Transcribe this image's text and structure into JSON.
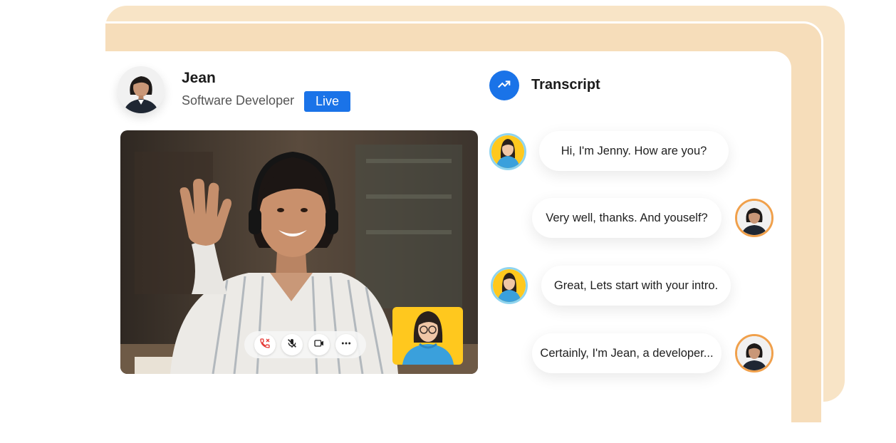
{
  "profile": {
    "name": "Jean",
    "role": "Software Developer",
    "status_badge": "Live"
  },
  "video_controls": [
    {
      "icon": "phone-end-icon",
      "color": "#e53935"
    },
    {
      "icon": "mic-off-icon",
      "color": "#222222"
    },
    {
      "icon": "video-camera-icon",
      "color": "#222222"
    },
    {
      "icon": "more-options-icon",
      "color": "#222222"
    }
  ],
  "transcript": {
    "title": "Transcript",
    "icon": "trending-up-icon",
    "messages": [
      {
        "speaker": "bot",
        "text": "Hi, I'm Jenny. How are you?"
      },
      {
        "speaker": "user",
        "text": "Very well, thanks. And youself?"
      },
      {
        "speaker": "bot",
        "text": "Great, Lets start with your intro."
      },
      {
        "speaker": "user",
        "text": "Certainly, I'm Jean, a developer..."
      }
    ]
  },
  "colors": {
    "accent": "#1a73e8",
    "backdrop": "#f8e4c6",
    "bot_ring": "#8fd4ef",
    "user_ring": "#f0a04b",
    "avatar_bg": "#ffc81e"
  }
}
